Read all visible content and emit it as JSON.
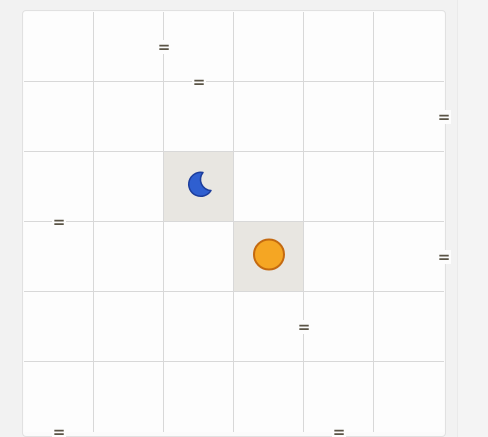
{
  "puzzle": {
    "rows": 6,
    "cols": 6,
    "cells": [
      [
        null,
        null,
        null,
        null,
        null,
        null
      ],
      [
        null,
        null,
        null,
        null,
        null,
        null
      ],
      [
        null,
        null,
        "moon",
        null,
        null,
        null
      ],
      [
        null,
        null,
        null,
        "sun",
        null,
        null
      ],
      [
        null,
        null,
        null,
        null,
        null,
        null
      ],
      [
        null,
        null,
        null,
        null,
        null,
        null
      ]
    ],
    "locked_cells": [
      [
        2,
        2
      ],
      [
        3,
        3
      ]
    ],
    "constraints": [
      {
        "type": "h",
        "row": 0,
        "col": 2,
        "symbol": "="
      },
      {
        "type": "v",
        "row": 0,
        "col": 1,
        "symbol": "="
      },
      {
        "type": "v",
        "row": 1,
        "col": 5,
        "symbol": "="
      },
      {
        "type": "h",
        "row": 2,
        "col": 0,
        "symbol": "="
      },
      {
        "type": "v",
        "row": 3,
        "col": 5,
        "symbol": "="
      },
      {
        "type": "v",
        "row": 4,
        "col": 3,
        "symbol": "="
      },
      {
        "type": "h",
        "row": 5,
        "col": 0,
        "symbol": "="
      },
      {
        "type": "h",
        "row": 5,
        "col": 4,
        "symbol": "="
      }
    ]
  },
  "colors": {
    "sun_fill": "#f5a623",
    "sun_stroke": "#c46a10",
    "moon_fill": "#2f5fd0",
    "moon_stroke": "#1c3d9c",
    "locked_bg": "#e8e6e1"
  },
  "icons": {
    "sun": "sun-icon",
    "moon": "moon-icon"
  }
}
